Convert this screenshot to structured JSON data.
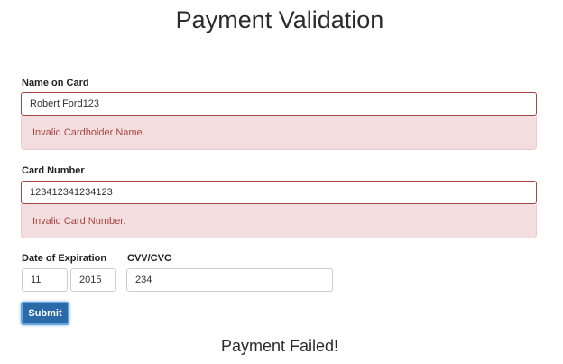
{
  "page": {
    "title": "Payment Validation"
  },
  "name_on_card": {
    "label": "Name on Card",
    "value": "Robert Ford123",
    "error": "Invalid Cardholder Name."
  },
  "card_number": {
    "label": "Card Number",
    "value": "123412341234123",
    "error": "Invalid Card Number."
  },
  "expiration": {
    "label": "Date of Expiration",
    "month": "11",
    "year": "2015"
  },
  "cvv": {
    "label": "CVV/CVC",
    "value": "234"
  },
  "submit": {
    "label": "Submit"
  },
  "result": {
    "message": "Payment Failed!"
  },
  "colors": {
    "error_text": "#a94442",
    "error_bg": "#f2dede",
    "primary_button": "#2a6aa8"
  }
}
